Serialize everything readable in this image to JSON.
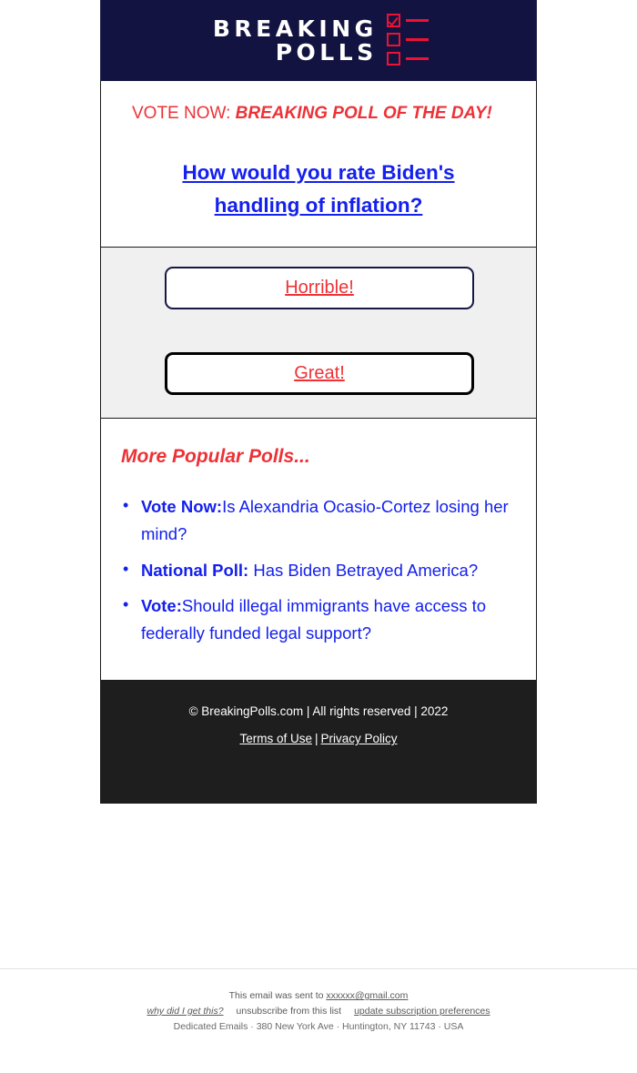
{
  "email": {
    "logo": {
      "line1": "BREAKING",
      "line2": "POLLS",
      "icon": "checklist-icon",
      "box_color": "#ee1133",
      "background": "#131342"
    },
    "kicker": {
      "lead": "VOTE NOW: ",
      "emphasis": "BREAKING POLL OF THE DAY!",
      "color": "#ed3237"
    },
    "question": {
      "line1": "How would you rate Biden's",
      "line2": "handling of inflation?",
      "color": "#1420ee"
    },
    "vote_buttons": [
      {
        "label": "Horrible!",
        "border_color": "#171744",
        "text_color": "#ed3237"
      },
      {
        "label": "Great!",
        "border_color": "#000000",
        "text_color": "#ed3237"
      }
    ],
    "more_polls": {
      "title": "More Popular Polls...",
      "title_color": "#ed3237",
      "items": [
        {
          "prefix": "Vote Now:",
          "text": "Is Alexandria Ocasio-Cortez losing her mind?"
        },
        {
          "prefix": "National Poll:",
          "text": " Has Biden Betrayed America?"
        },
        {
          "prefix": "Vote:",
          "text": "Should illegal immigrants have access to federally funded legal support?"
        }
      ]
    },
    "footer": {
      "copyright": "© BreakingPolls.com | All rights reserved | 2022",
      "terms_label": "Terms of Use",
      "separator": "|",
      "privacy_label": "Privacy Policy",
      "background": "#1e1e1e"
    }
  },
  "client_footer": {
    "sent_to_prefix": "This email was sent to ",
    "sent_to_email": "xxxxxx@gmail.com",
    "why_label": "why did I get this?",
    "unsubscribe_label": "unsubscribe from this list",
    "update_label": "update subscription preferences",
    "address": "Dedicated Emails · 380 New York Ave · Huntington, NY 11743 · USA"
  }
}
